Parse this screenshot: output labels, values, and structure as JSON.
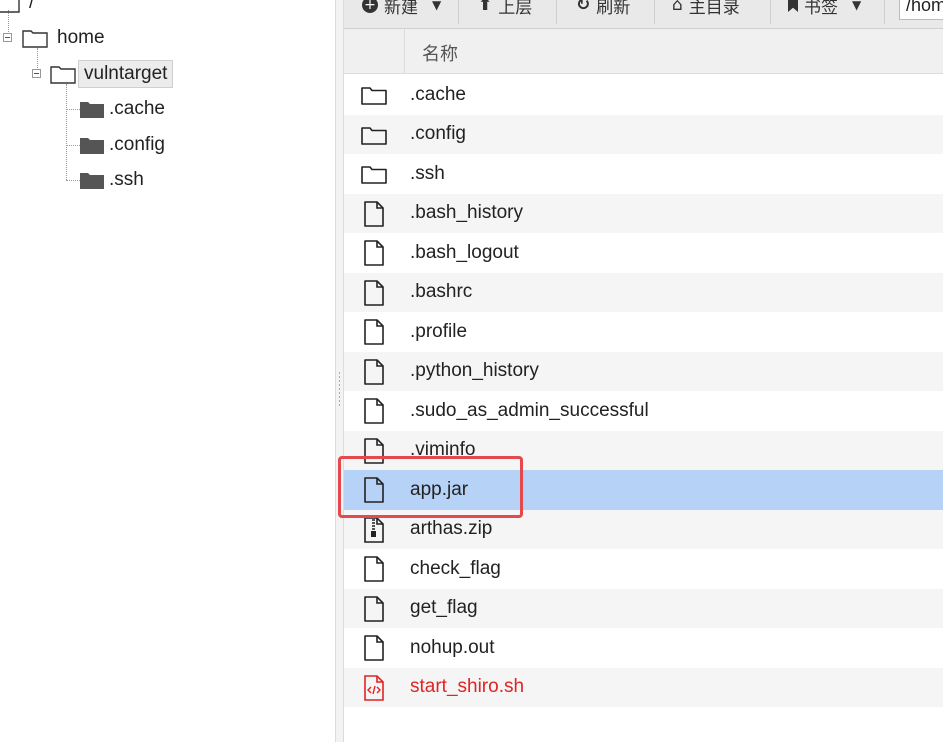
{
  "tree": {
    "root_label": "/",
    "home_label": "home",
    "user_label": "vulntarget",
    "children": [
      ".cache",
      ".config",
      ".ssh"
    ]
  },
  "toolbar": {
    "new_label": "新建",
    "up_label": "上层",
    "refresh_label": "刷新",
    "home_label": "主目录",
    "bookmark_label": "书签",
    "path_value": "/hom"
  },
  "list": {
    "header_name": "名称",
    "files": [
      {
        "name": ".cache",
        "icon": "folder-icon"
      },
      {
        "name": ".config",
        "icon": "folder-icon"
      },
      {
        "name": ".ssh",
        "icon": "folder-icon"
      },
      {
        "name": ".bash_history",
        "icon": "file-icon"
      },
      {
        "name": ".bash_logout",
        "icon": "file-icon"
      },
      {
        "name": ".bashrc",
        "icon": "file-icon"
      },
      {
        "name": ".profile",
        "icon": "file-icon"
      },
      {
        "name": ".python_history",
        "icon": "file-icon"
      },
      {
        "name": ".sudo_as_admin_successful",
        "icon": "file-icon"
      },
      {
        "name": ".viminfo",
        "icon": "file-icon"
      },
      {
        "name": "app.jar",
        "icon": "file-icon"
      },
      {
        "name": "arthas.zip",
        "icon": "zip-file-icon"
      },
      {
        "name": "check_flag",
        "icon": "file-icon"
      },
      {
        "name": "get_flag",
        "icon": "file-icon"
      },
      {
        "name": "nohup.out",
        "icon": "file-icon"
      },
      {
        "name": "start_shiro.sh",
        "icon": "script-file-icon"
      }
    ],
    "selected": "app.jar"
  },
  "colors": {
    "selection": "#b7d2f7",
    "highlight_box": "#e5484d",
    "script_text": "#e02424"
  }
}
